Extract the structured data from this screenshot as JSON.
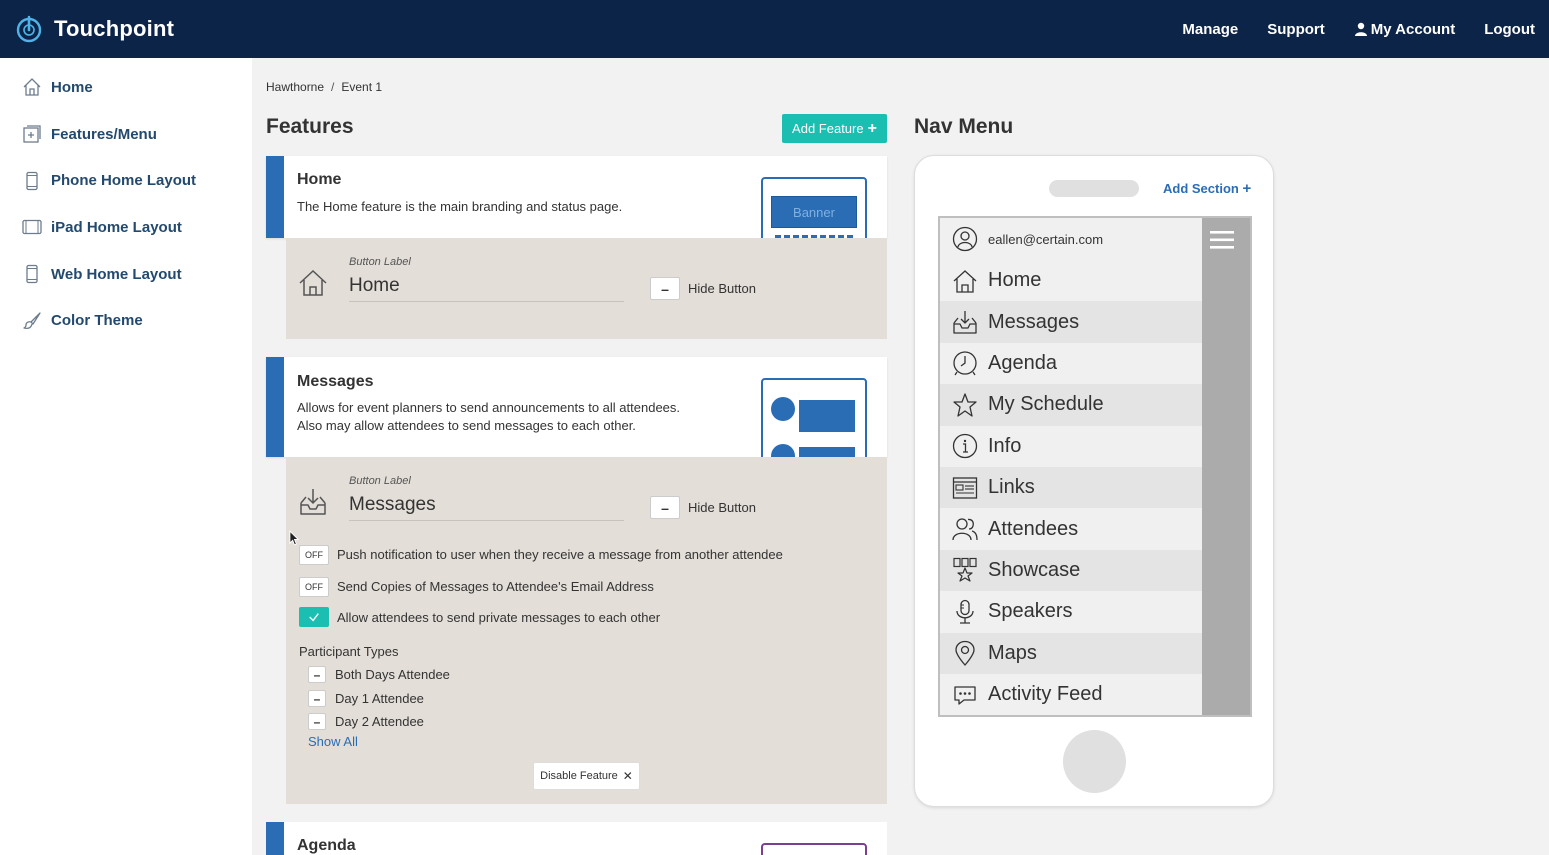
{
  "app": {
    "name": "Touchpoint"
  },
  "topnav": {
    "manage": "Manage",
    "support": "Support",
    "account": "My Account",
    "logout": "Logout"
  },
  "sidebar": {
    "items": [
      {
        "label": "Home",
        "icon": "home-icon"
      },
      {
        "label": "Features/Menu",
        "icon": "add-box-icon"
      },
      {
        "label": "Phone Home Layout",
        "icon": "phone-icon"
      },
      {
        "label": "iPad Home Layout",
        "icon": "tablet-icon"
      },
      {
        "label": "Web Home Layout",
        "icon": "phone-icon"
      },
      {
        "label": "Color Theme",
        "icon": "brush-icon"
      }
    ]
  },
  "breadcrumb": {
    "root": "Hawthorne",
    "sep": "/",
    "current": "Event 1"
  },
  "features": {
    "title": "Features",
    "add_label": "Add Feature",
    "add_plus": "+",
    "home": {
      "title": "Home",
      "description": "The Home feature is the main branding and status page.",
      "preview_text": "Banner",
      "button_label_caption": "Button Label",
      "button_label": "Home",
      "hide_minus": "–",
      "hide_label": "Hide Button"
    },
    "messages": {
      "title": "Messages",
      "description_1": "Allows for event planners to send announcements to all attendees.",
      "description_2": "Also may allow attendees to send messages to each other.",
      "button_label_caption": "Button Label",
      "button_label": "Messages",
      "hide_minus": "–",
      "hide_label": "Hide Button",
      "options": [
        {
          "state": "OFF",
          "label": "Push notification to user when they receive a message from another attendee"
        },
        {
          "state": "OFF",
          "label": "Send Copies of Messages to Attendee's Email Address"
        },
        {
          "state": "on",
          "label": "Allow attendees to send private messages to each other"
        }
      ],
      "participant_types_title": "Participant Types",
      "participant_types": [
        "Both Days Attendee",
        "Day 1 Attendee",
        "Day 2 Attendee"
      ],
      "show_all": "Show All",
      "disable_label": "Disable Feature",
      "disable_x": "✕"
    },
    "agenda": {
      "title": "Agenda"
    }
  },
  "nav_menu": {
    "title": "Nav Menu",
    "add_section": "Add Section",
    "add_plus": "+",
    "email": "eallen@certain.com",
    "items": [
      {
        "label": "Home",
        "icon": "home-icon"
      },
      {
        "label": "Messages",
        "icon": "inbox-icon"
      },
      {
        "label": "Agenda",
        "icon": "clock-icon"
      },
      {
        "label": "My Schedule",
        "icon": "star-icon"
      },
      {
        "label": "Info",
        "icon": "info-icon"
      },
      {
        "label": "Links",
        "icon": "links-icon"
      },
      {
        "label": "Attendees",
        "icon": "people-icon"
      },
      {
        "label": "Showcase",
        "icon": "showcase-icon"
      },
      {
        "label": "Speakers",
        "icon": "microphone-icon"
      },
      {
        "label": "Maps",
        "icon": "map-pin-icon"
      },
      {
        "label": "Activity Feed",
        "icon": "chat-icon"
      }
    ]
  },
  "colors": {
    "topbar": "#0b2447",
    "accent": "#1bbfb2",
    "blue": "#2a6db5"
  }
}
